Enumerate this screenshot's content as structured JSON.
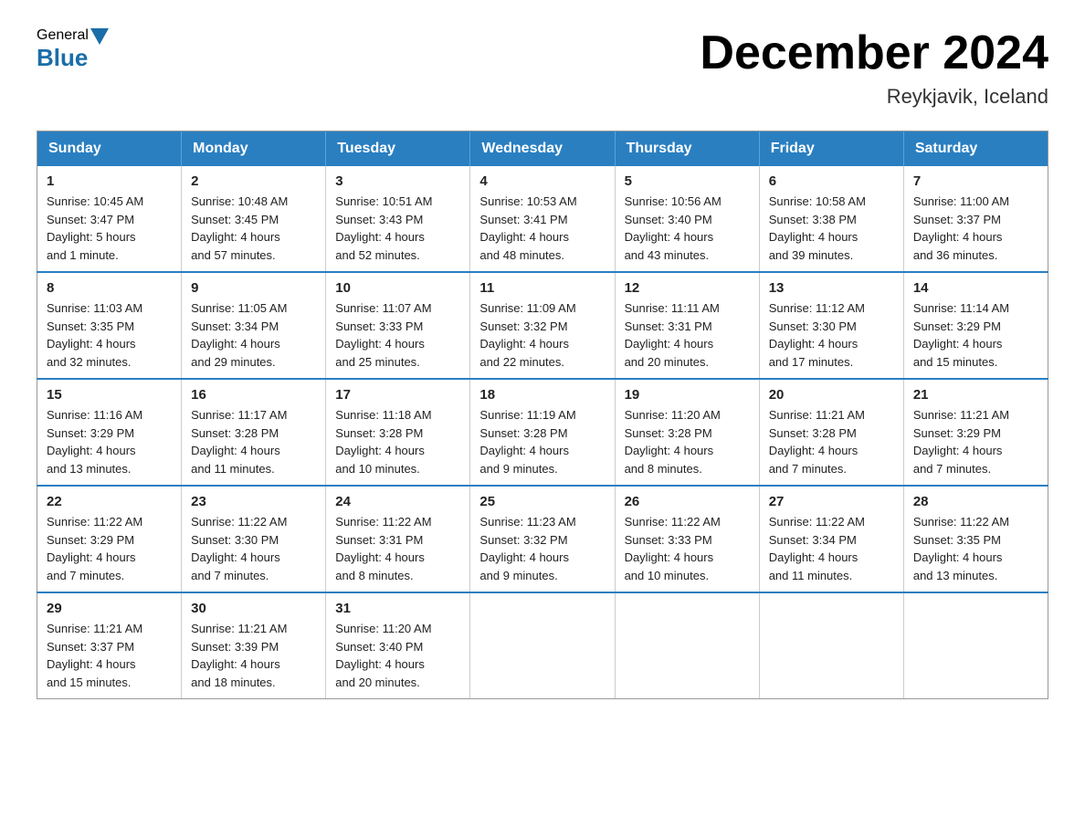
{
  "header": {
    "logo_general": "General",
    "logo_blue": "Blue",
    "title": "December 2024",
    "subtitle": "Reykjavik, Iceland"
  },
  "days_of_week": [
    "Sunday",
    "Monday",
    "Tuesday",
    "Wednesday",
    "Thursday",
    "Friday",
    "Saturday"
  ],
  "weeks": [
    [
      {
        "day": "1",
        "sunrise": "Sunrise: 10:45 AM",
        "sunset": "Sunset: 3:47 PM",
        "daylight": "Daylight: 5 hours and 1 minute."
      },
      {
        "day": "2",
        "sunrise": "Sunrise: 10:48 AM",
        "sunset": "Sunset: 3:45 PM",
        "daylight": "Daylight: 4 hours and 57 minutes."
      },
      {
        "day": "3",
        "sunrise": "Sunrise: 10:51 AM",
        "sunset": "Sunset: 3:43 PM",
        "daylight": "Daylight: 4 hours and 52 minutes."
      },
      {
        "day": "4",
        "sunrise": "Sunrise: 10:53 AM",
        "sunset": "Sunset: 3:41 PM",
        "daylight": "Daylight: 4 hours and 48 minutes."
      },
      {
        "day": "5",
        "sunrise": "Sunrise: 10:56 AM",
        "sunset": "Sunset: 3:40 PM",
        "daylight": "Daylight: 4 hours and 43 minutes."
      },
      {
        "day": "6",
        "sunrise": "Sunrise: 10:58 AM",
        "sunset": "Sunset: 3:38 PM",
        "daylight": "Daylight: 4 hours and 39 minutes."
      },
      {
        "day": "7",
        "sunrise": "Sunrise: 11:00 AM",
        "sunset": "Sunset: 3:37 PM",
        "daylight": "Daylight: 4 hours and 36 minutes."
      }
    ],
    [
      {
        "day": "8",
        "sunrise": "Sunrise: 11:03 AM",
        "sunset": "Sunset: 3:35 PM",
        "daylight": "Daylight: 4 hours and 32 minutes."
      },
      {
        "day": "9",
        "sunrise": "Sunrise: 11:05 AM",
        "sunset": "Sunset: 3:34 PM",
        "daylight": "Daylight: 4 hours and 29 minutes."
      },
      {
        "day": "10",
        "sunrise": "Sunrise: 11:07 AM",
        "sunset": "Sunset: 3:33 PM",
        "daylight": "Daylight: 4 hours and 25 minutes."
      },
      {
        "day": "11",
        "sunrise": "Sunrise: 11:09 AM",
        "sunset": "Sunset: 3:32 PM",
        "daylight": "Daylight: 4 hours and 22 minutes."
      },
      {
        "day": "12",
        "sunrise": "Sunrise: 11:11 AM",
        "sunset": "Sunset: 3:31 PM",
        "daylight": "Daylight: 4 hours and 20 minutes."
      },
      {
        "day": "13",
        "sunrise": "Sunrise: 11:12 AM",
        "sunset": "Sunset: 3:30 PM",
        "daylight": "Daylight: 4 hours and 17 minutes."
      },
      {
        "day": "14",
        "sunrise": "Sunrise: 11:14 AM",
        "sunset": "Sunset: 3:29 PM",
        "daylight": "Daylight: 4 hours and 15 minutes."
      }
    ],
    [
      {
        "day": "15",
        "sunrise": "Sunrise: 11:16 AM",
        "sunset": "Sunset: 3:29 PM",
        "daylight": "Daylight: 4 hours and 13 minutes."
      },
      {
        "day": "16",
        "sunrise": "Sunrise: 11:17 AM",
        "sunset": "Sunset: 3:28 PM",
        "daylight": "Daylight: 4 hours and 11 minutes."
      },
      {
        "day": "17",
        "sunrise": "Sunrise: 11:18 AM",
        "sunset": "Sunset: 3:28 PM",
        "daylight": "Daylight: 4 hours and 10 minutes."
      },
      {
        "day": "18",
        "sunrise": "Sunrise: 11:19 AM",
        "sunset": "Sunset: 3:28 PM",
        "daylight": "Daylight: 4 hours and 9 minutes."
      },
      {
        "day": "19",
        "sunrise": "Sunrise: 11:20 AM",
        "sunset": "Sunset: 3:28 PM",
        "daylight": "Daylight: 4 hours and 8 minutes."
      },
      {
        "day": "20",
        "sunrise": "Sunrise: 11:21 AM",
        "sunset": "Sunset: 3:28 PM",
        "daylight": "Daylight: 4 hours and 7 minutes."
      },
      {
        "day": "21",
        "sunrise": "Sunrise: 11:21 AM",
        "sunset": "Sunset: 3:29 PM",
        "daylight": "Daylight: 4 hours and 7 minutes."
      }
    ],
    [
      {
        "day": "22",
        "sunrise": "Sunrise: 11:22 AM",
        "sunset": "Sunset: 3:29 PM",
        "daylight": "Daylight: 4 hours and 7 minutes."
      },
      {
        "day": "23",
        "sunrise": "Sunrise: 11:22 AM",
        "sunset": "Sunset: 3:30 PM",
        "daylight": "Daylight: 4 hours and 7 minutes."
      },
      {
        "day": "24",
        "sunrise": "Sunrise: 11:22 AM",
        "sunset": "Sunset: 3:31 PM",
        "daylight": "Daylight: 4 hours and 8 minutes."
      },
      {
        "day": "25",
        "sunrise": "Sunrise: 11:23 AM",
        "sunset": "Sunset: 3:32 PM",
        "daylight": "Daylight: 4 hours and 9 minutes."
      },
      {
        "day": "26",
        "sunrise": "Sunrise: 11:22 AM",
        "sunset": "Sunset: 3:33 PM",
        "daylight": "Daylight: 4 hours and 10 minutes."
      },
      {
        "day": "27",
        "sunrise": "Sunrise: 11:22 AM",
        "sunset": "Sunset: 3:34 PM",
        "daylight": "Daylight: 4 hours and 11 minutes."
      },
      {
        "day": "28",
        "sunrise": "Sunrise: 11:22 AM",
        "sunset": "Sunset: 3:35 PM",
        "daylight": "Daylight: 4 hours and 13 minutes."
      }
    ],
    [
      {
        "day": "29",
        "sunrise": "Sunrise: 11:21 AM",
        "sunset": "Sunset: 3:37 PM",
        "daylight": "Daylight: 4 hours and 15 minutes."
      },
      {
        "day": "30",
        "sunrise": "Sunrise: 11:21 AM",
        "sunset": "Sunset: 3:39 PM",
        "daylight": "Daylight: 4 hours and 18 minutes."
      },
      {
        "day": "31",
        "sunrise": "Sunrise: 11:20 AM",
        "sunset": "Sunset: 3:40 PM",
        "daylight": "Daylight: 4 hours and 20 minutes."
      },
      null,
      null,
      null,
      null
    ]
  ]
}
